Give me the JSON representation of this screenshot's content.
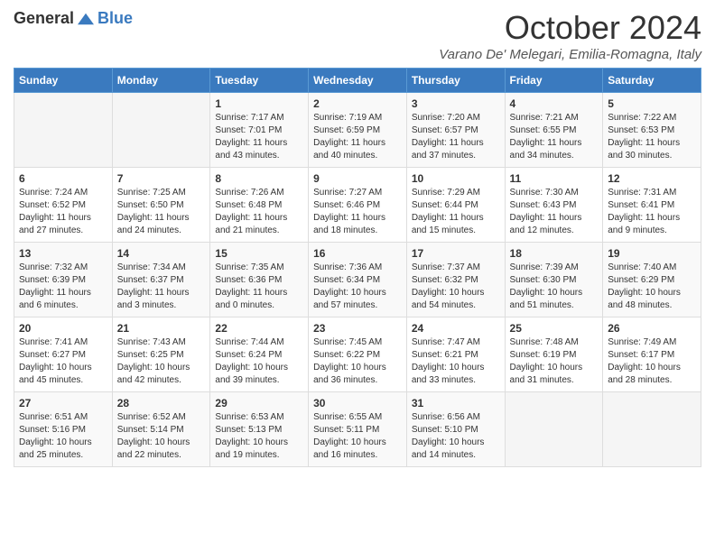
{
  "header": {
    "logo_general": "General",
    "logo_blue": "Blue",
    "month_title": "October 2024",
    "location": "Varano De' Melegari, Emilia-Romagna, Italy"
  },
  "days_of_week": [
    "Sunday",
    "Monday",
    "Tuesday",
    "Wednesday",
    "Thursday",
    "Friday",
    "Saturday"
  ],
  "weeks": [
    [
      {
        "day": "",
        "sunrise": "",
        "sunset": "",
        "daylight": ""
      },
      {
        "day": "",
        "sunrise": "",
        "sunset": "",
        "daylight": ""
      },
      {
        "day": "1",
        "sunrise": "Sunrise: 7:17 AM",
        "sunset": "Sunset: 7:01 PM",
        "daylight": "Daylight: 11 hours and 43 minutes."
      },
      {
        "day": "2",
        "sunrise": "Sunrise: 7:19 AM",
        "sunset": "Sunset: 6:59 PM",
        "daylight": "Daylight: 11 hours and 40 minutes."
      },
      {
        "day": "3",
        "sunrise": "Sunrise: 7:20 AM",
        "sunset": "Sunset: 6:57 PM",
        "daylight": "Daylight: 11 hours and 37 minutes."
      },
      {
        "day": "4",
        "sunrise": "Sunrise: 7:21 AM",
        "sunset": "Sunset: 6:55 PM",
        "daylight": "Daylight: 11 hours and 34 minutes."
      },
      {
        "day": "5",
        "sunrise": "Sunrise: 7:22 AM",
        "sunset": "Sunset: 6:53 PM",
        "daylight": "Daylight: 11 hours and 30 minutes."
      }
    ],
    [
      {
        "day": "6",
        "sunrise": "Sunrise: 7:24 AM",
        "sunset": "Sunset: 6:52 PM",
        "daylight": "Daylight: 11 hours and 27 minutes."
      },
      {
        "day": "7",
        "sunrise": "Sunrise: 7:25 AM",
        "sunset": "Sunset: 6:50 PM",
        "daylight": "Daylight: 11 hours and 24 minutes."
      },
      {
        "day": "8",
        "sunrise": "Sunrise: 7:26 AM",
        "sunset": "Sunset: 6:48 PM",
        "daylight": "Daylight: 11 hours and 21 minutes."
      },
      {
        "day": "9",
        "sunrise": "Sunrise: 7:27 AM",
        "sunset": "Sunset: 6:46 PM",
        "daylight": "Daylight: 11 hours and 18 minutes."
      },
      {
        "day": "10",
        "sunrise": "Sunrise: 7:29 AM",
        "sunset": "Sunset: 6:44 PM",
        "daylight": "Daylight: 11 hours and 15 minutes."
      },
      {
        "day": "11",
        "sunrise": "Sunrise: 7:30 AM",
        "sunset": "Sunset: 6:43 PM",
        "daylight": "Daylight: 11 hours and 12 minutes."
      },
      {
        "day": "12",
        "sunrise": "Sunrise: 7:31 AM",
        "sunset": "Sunset: 6:41 PM",
        "daylight": "Daylight: 11 hours and 9 minutes."
      }
    ],
    [
      {
        "day": "13",
        "sunrise": "Sunrise: 7:32 AM",
        "sunset": "Sunset: 6:39 PM",
        "daylight": "Daylight: 11 hours and 6 minutes."
      },
      {
        "day": "14",
        "sunrise": "Sunrise: 7:34 AM",
        "sunset": "Sunset: 6:37 PM",
        "daylight": "Daylight: 11 hours and 3 minutes."
      },
      {
        "day": "15",
        "sunrise": "Sunrise: 7:35 AM",
        "sunset": "Sunset: 6:36 PM",
        "daylight": "Daylight: 11 hours and 0 minutes."
      },
      {
        "day": "16",
        "sunrise": "Sunrise: 7:36 AM",
        "sunset": "Sunset: 6:34 PM",
        "daylight": "Daylight: 10 hours and 57 minutes."
      },
      {
        "day": "17",
        "sunrise": "Sunrise: 7:37 AM",
        "sunset": "Sunset: 6:32 PM",
        "daylight": "Daylight: 10 hours and 54 minutes."
      },
      {
        "day": "18",
        "sunrise": "Sunrise: 7:39 AM",
        "sunset": "Sunset: 6:30 PM",
        "daylight": "Daylight: 10 hours and 51 minutes."
      },
      {
        "day": "19",
        "sunrise": "Sunrise: 7:40 AM",
        "sunset": "Sunset: 6:29 PM",
        "daylight": "Daylight: 10 hours and 48 minutes."
      }
    ],
    [
      {
        "day": "20",
        "sunrise": "Sunrise: 7:41 AM",
        "sunset": "Sunset: 6:27 PM",
        "daylight": "Daylight: 10 hours and 45 minutes."
      },
      {
        "day": "21",
        "sunrise": "Sunrise: 7:43 AM",
        "sunset": "Sunset: 6:25 PM",
        "daylight": "Daylight: 10 hours and 42 minutes."
      },
      {
        "day": "22",
        "sunrise": "Sunrise: 7:44 AM",
        "sunset": "Sunset: 6:24 PM",
        "daylight": "Daylight: 10 hours and 39 minutes."
      },
      {
        "day": "23",
        "sunrise": "Sunrise: 7:45 AM",
        "sunset": "Sunset: 6:22 PM",
        "daylight": "Daylight: 10 hours and 36 minutes."
      },
      {
        "day": "24",
        "sunrise": "Sunrise: 7:47 AM",
        "sunset": "Sunset: 6:21 PM",
        "daylight": "Daylight: 10 hours and 33 minutes."
      },
      {
        "day": "25",
        "sunrise": "Sunrise: 7:48 AM",
        "sunset": "Sunset: 6:19 PM",
        "daylight": "Daylight: 10 hours and 31 minutes."
      },
      {
        "day": "26",
        "sunrise": "Sunrise: 7:49 AM",
        "sunset": "Sunset: 6:17 PM",
        "daylight": "Daylight: 10 hours and 28 minutes."
      }
    ],
    [
      {
        "day": "27",
        "sunrise": "Sunrise: 6:51 AM",
        "sunset": "Sunset: 5:16 PM",
        "daylight": "Daylight: 10 hours and 25 minutes."
      },
      {
        "day": "28",
        "sunrise": "Sunrise: 6:52 AM",
        "sunset": "Sunset: 5:14 PM",
        "daylight": "Daylight: 10 hours and 22 minutes."
      },
      {
        "day": "29",
        "sunrise": "Sunrise: 6:53 AM",
        "sunset": "Sunset: 5:13 PM",
        "daylight": "Daylight: 10 hours and 19 minutes."
      },
      {
        "day": "30",
        "sunrise": "Sunrise: 6:55 AM",
        "sunset": "Sunset: 5:11 PM",
        "daylight": "Daylight: 10 hours and 16 minutes."
      },
      {
        "day": "31",
        "sunrise": "Sunrise: 6:56 AM",
        "sunset": "Sunset: 5:10 PM",
        "daylight": "Daylight: 10 hours and 14 minutes."
      },
      {
        "day": "",
        "sunrise": "",
        "sunset": "",
        "daylight": ""
      },
      {
        "day": "",
        "sunrise": "",
        "sunset": "",
        "daylight": ""
      }
    ]
  ]
}
